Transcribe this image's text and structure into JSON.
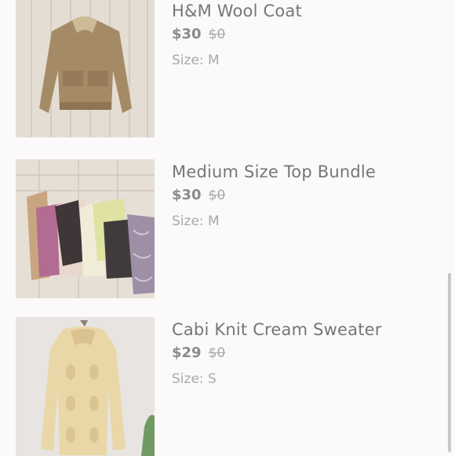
{
  "listings": [
    {
      "title": "H&M Wool Coat",
      "price": "$30",
      "original_price": "$0",
      "size": "Size: M"
    },
    {
      "title": "Medium Size Top Bundle",
      "price": "$30",
      "original_price": "$0",
      "size": "Size: M"
    },
    {
      "title": "Cabi Knit Cream Sweater",
      "price": "$29",
      "original_price": "$0",
      "size": "Size: S"
    }
  ]
}
